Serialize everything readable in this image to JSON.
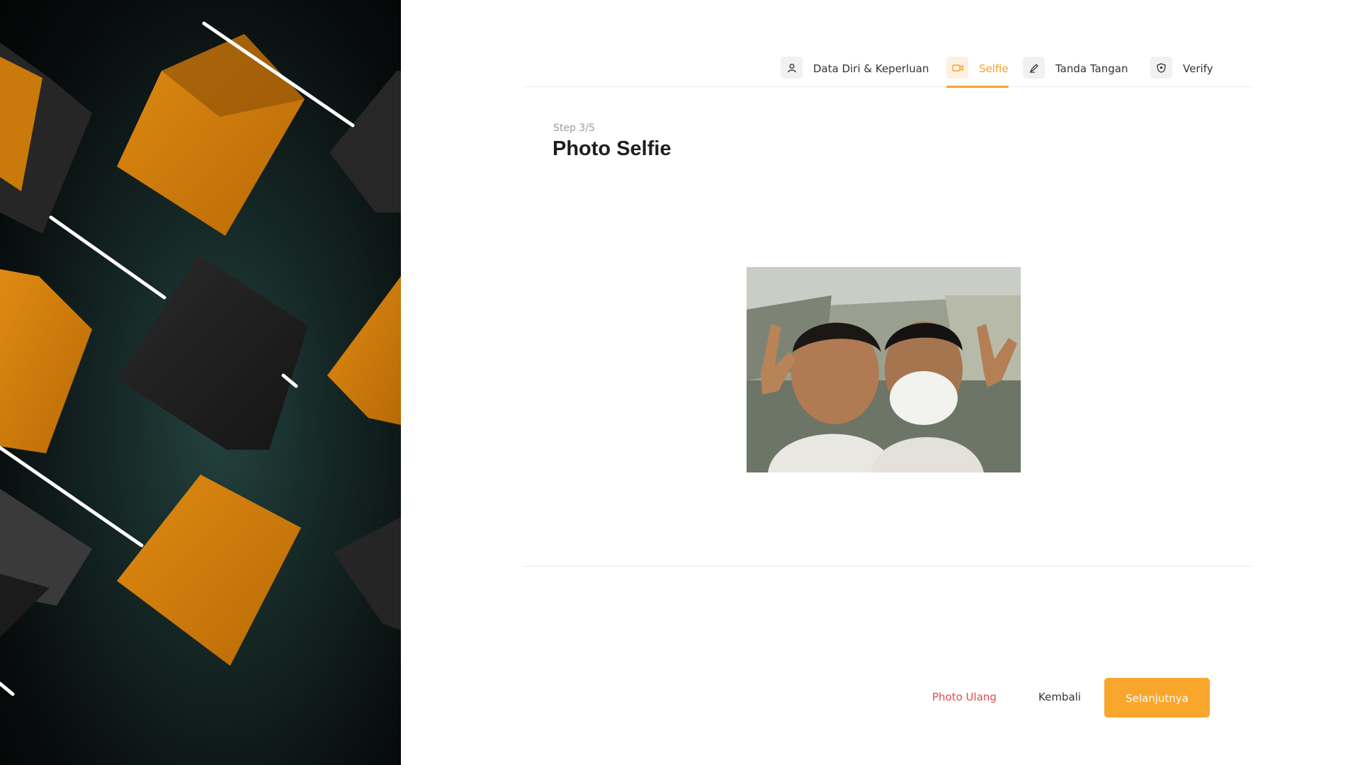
{
  "stepper": {
    "steps": [
      {
        "label": "Data Diri & Keperluan",
        "icon": "user-icon",
        "active": false
      },
      {
        "label": "Selfie",
        "icon": "camera-icon",
        "active": true
      },
      {
        "label": "Tanda Tangan",
        "icon": "pen-icon",
        "active": false
      },
      {
        "label": "Verify",
        "icon": "shield-icon",
        "active": false
      }
    ]
  },
  "main": {
    "step_counter": "Step 3/5",
    "title": "Photo Selfie"
  },
  "actions": {
    "retake_label": "Photo Ulang",
    "back_label": "Kembali",
    "next_label": "Selanjutnya"
  },
  "colors": {
    "accent": "#f8a62c",
    "danger": "#e5484d",
    "cube_orange": "#d07f0c",
    "panel_dark": "#0b1212"
  }
}
